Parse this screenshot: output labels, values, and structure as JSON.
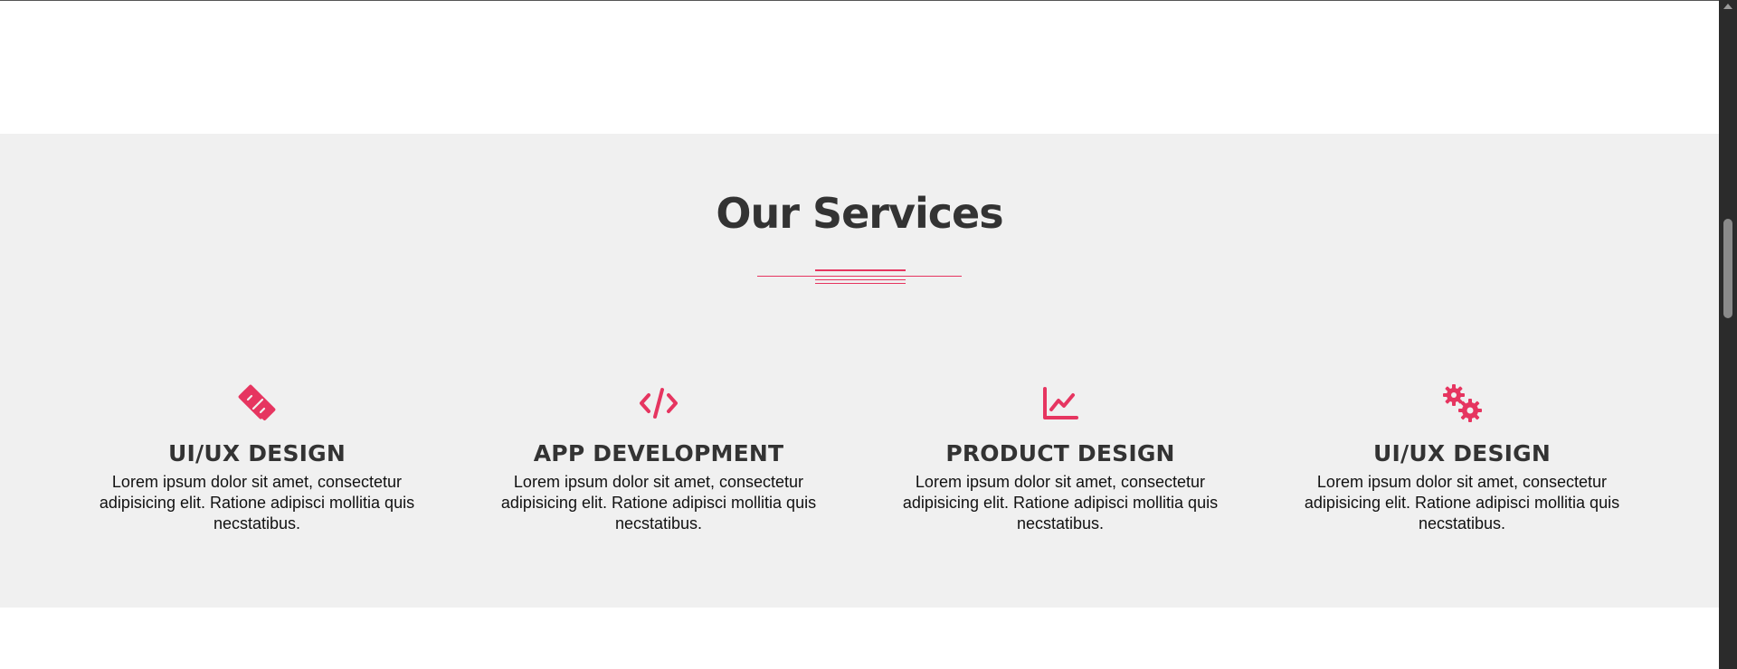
{
  "services_section": {
    "title": "Our Services",
    "accent_color": "#e63560",
    "items": [
      {
        "icon": "pencil-ruler-icon",
        "title": "UI/UX DESIGN",
        "description": "Lorem ipsum dolor sit amet, consectetur adipisicing elit. Ratione adipisci mollitia quis necstatibus."
      },
      {
        "icon": "code-icon",
        "title": "APP DEVELOPMENT",
        "description": "Lorem ipsum dolor sit amet, consectetur adipisicing elit. Ratione adipisci mollitia quis necstatibus."
      },
      {
        "icon": "chart-line-icon",
        "title": "PRODUCT DESIGN",
        "description": "Lorem ipsum dolor sit amet, consectetur adipisicing elit. Ratione adipisci mollitia quis necstatibus."
      },
      {
        "icon": "cogs-icon",
        "title": "UI/UX DESIGN",
        "description": "Lorem ipsum dolor sit amet, consectetur adipisicing elit. Ratione adipisci mollitia quis necstatibus."
      }
    ]
  }
}
